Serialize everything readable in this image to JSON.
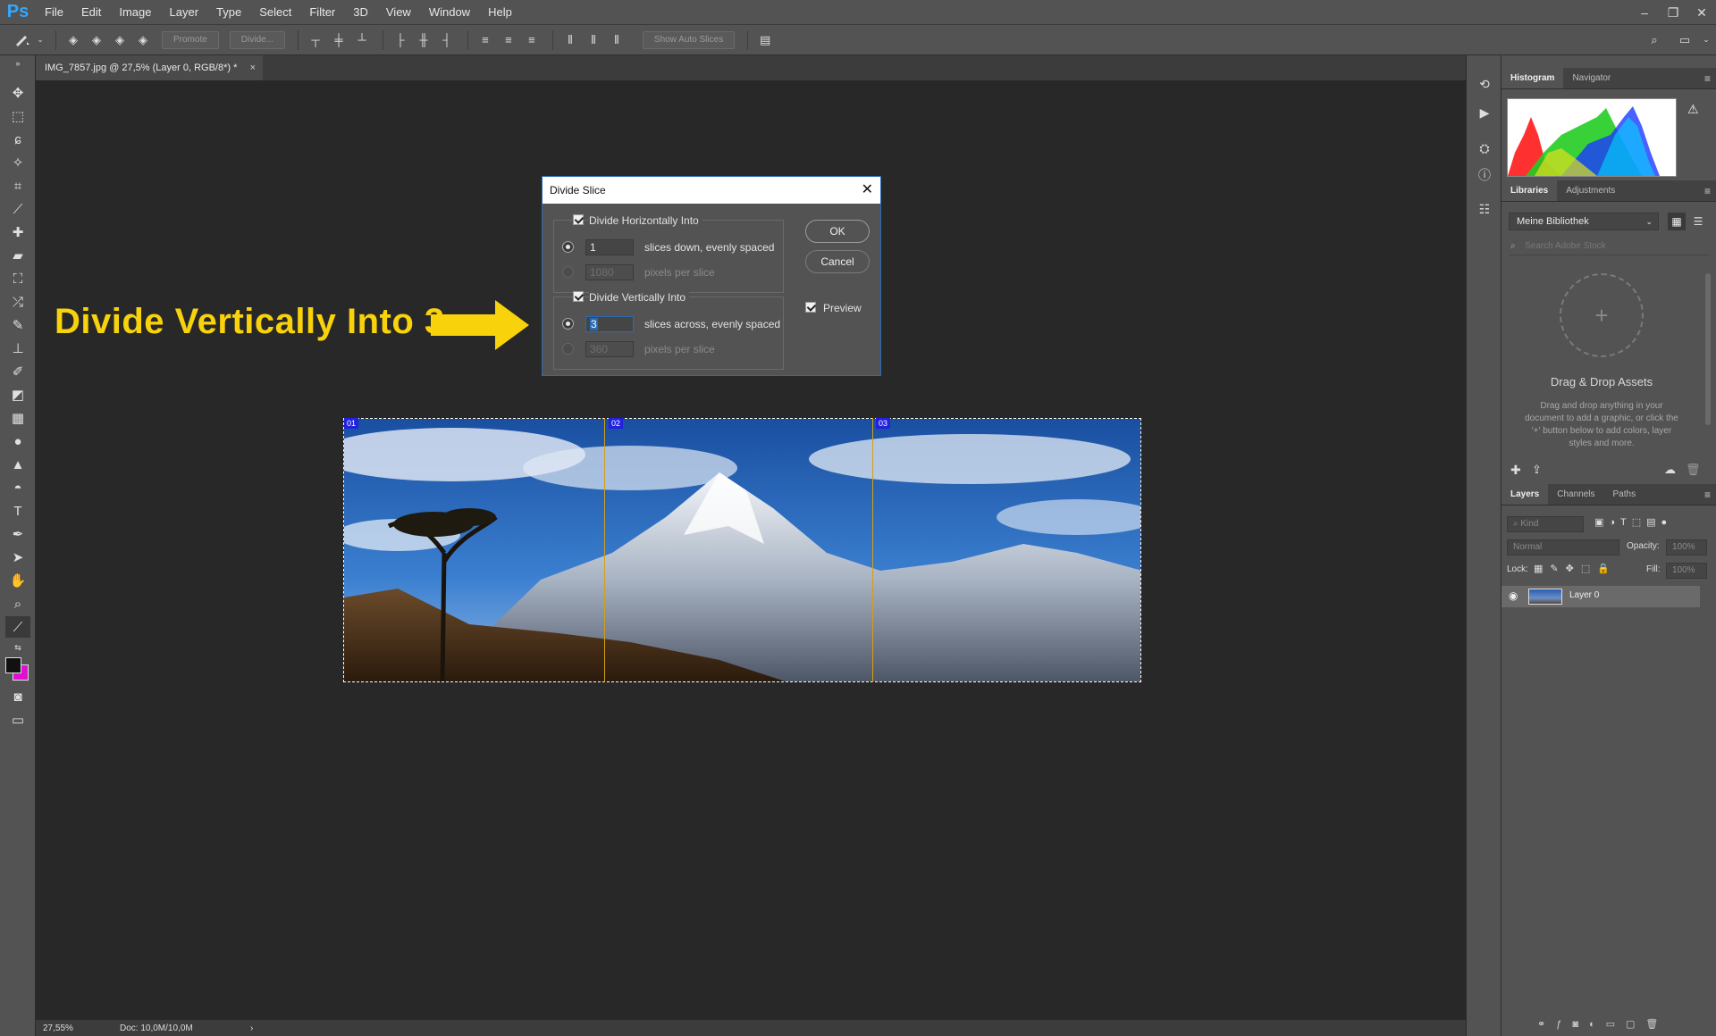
{
  "app": {
    "logo": "Ps"
  },
  "menu": [
    "File",
    "Edit",
    "Image",
    "Layer",
    "Type",
    "Select",
    "Filter",
    "3D",
    "View",
    "Window",
    "Help"
  ],
  "window_controls": {
    "minimize": "–",
    "restore": "❐",
    "close": "✕"
  },
  "options_bar": {
    "promote": "Promote",
    "divide": "Divide...",
    "show_auto_slices": "Show Auto Slices"
  },
  "document": {
    "tab_title": "IMG_7857.jpg @ 27,5% (Layer 0, RGB/8*) *",
    "close": "×",
    "zoom": "27,55%",
    "doc_size": "Doc: 10,0M/10,0M",
    "status_arrow": "›",
    "slices": [
      "01",
      "02",
      "03"
    ]
  },
  "annotation": {
    "text": "Divide Vertically Into 3",
    "color": "#f8d20a"
  },
  "dialog": {
    "title": "Divide Slice",
    "close": "✕",
    "horizontal": {
      "label": "Divide Horizontally Into",
      "count": "1",
      "count_label": "slices down, evenly spaced",
      "pixels": "1080",
      "pixels_label": "pixels per slice"
    },
    "vertical": {
      "label": "Divide Vertically Into",
      "count": "3",
      "count_label": "slices across, evenly spaced",
      "pixels": "360",
      "pixels_label": "pixels per slice"
    },
    "ok": "OK",
    "cancel": "Cancel",
    "preview": "Preview"
  },
  "panels": {
    "histogram_tabs": [
      "Histogram",
      "Navigator"
    ],
    "warning": "⚠",
    "libraries_tabs": [
      "Libraries",
      "Adjustments"
    ],
    "library_select": "Meine Bibliothek",
    "search_placeholder": "Search Adobe Stock",
    "drop_plus": "+",
    "drop_title": "Drag & Drop Assets",
    "drop_desc": "Drag and drop anything in your document to add a graphic, or click the '+' button below to add colors, layer styles and more.",
    "layers_tabs": [
      "Layers",
      "Channels",
      "Paths"
    ],
    "kind": "Kind",
    "blend_mode": "Normal",
    "opacity_label": "Opacity:",
    "opacity": "100%",
    "lock_label": "Lock:",
    "fill_label": "Fill:",
    "fill": "100%",
    "layer_name": "Layer 0"
  },
  "colors": {
    "accent": "#2a6ab5",
    "slice_line": "#d3a017",
    "slice_badge": "#2222dd",
    "annotation": "#f8d20a"
  }
}
